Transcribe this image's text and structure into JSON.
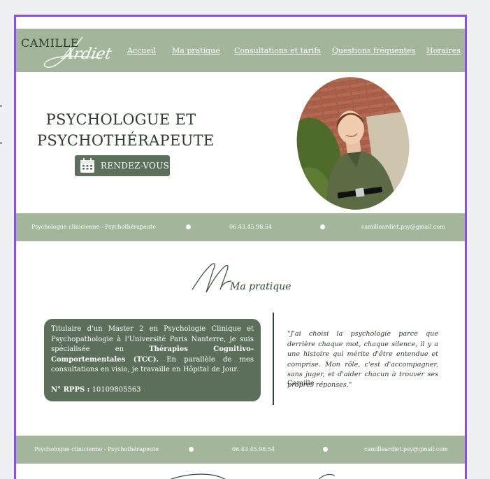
{
  "logo": {
    "first": "CAMILLE",
    "last": "Ardiet"
  },
  "nav": {
    "items": [
      {
        "label": "Accueil"
      },
      {
        "label": "Ma pratique"
      },
      {
        "label": "Consultations et tarifs"
      },
      {
        "label": "Questions fréquentes"
      },
      {
        "label": "Horaires"
      }
    ]
  },
  "hero": {
    "title_line1": "PSYCHOLOGUE ET",
    "title_line2": "PSYCHOTHÉRAPEUTE",
    "button_label": "RENDEZ-VOUS",
    "button_icon": "calendar-icon"
  },
  "info_band": {
    "title": "Psychologue clinicienne - Psychothérapeute",
    "phone": "06.43.45.98.54",
    "email": "camilleardiet.psy@gmail.com"
  },
  "practice": {
    "heading": "Ma pratique",
    "card": {
      "intro": "Titulaire d'un Master 2 en Psychologie Clinique et Psychopathologie à l'Université Paris Nanterre, je suis spécialisée en ",
      "bold": "Thérapies Cognitivo-Comportementales (TCC).",
      "rest": " En parallèle de mes consultations en visio, je travaille en Hôpital de Jour.",
      "rpps_label": "N° RPPS :",
      "rpps_value": "10109805563"
    },
    "quote": "\"J'ai choisi la psychologie parce que derrière chaque mot, chaque silence, il y a une histoire qui mérite d'être entendue et comprise. Mon rôle, c'est d'accompagner, sans juger, et d'aider chacun à trouver ses propres réponses.\"",
    "quote_author": "Camille"
  },
  "colors": {
    "sage": "#a3b69c",
    "dark_green": "#5b6f5b",
    "text_green": "#2d3d2d",
    "frame": "#8b4ee8"
  }
}
